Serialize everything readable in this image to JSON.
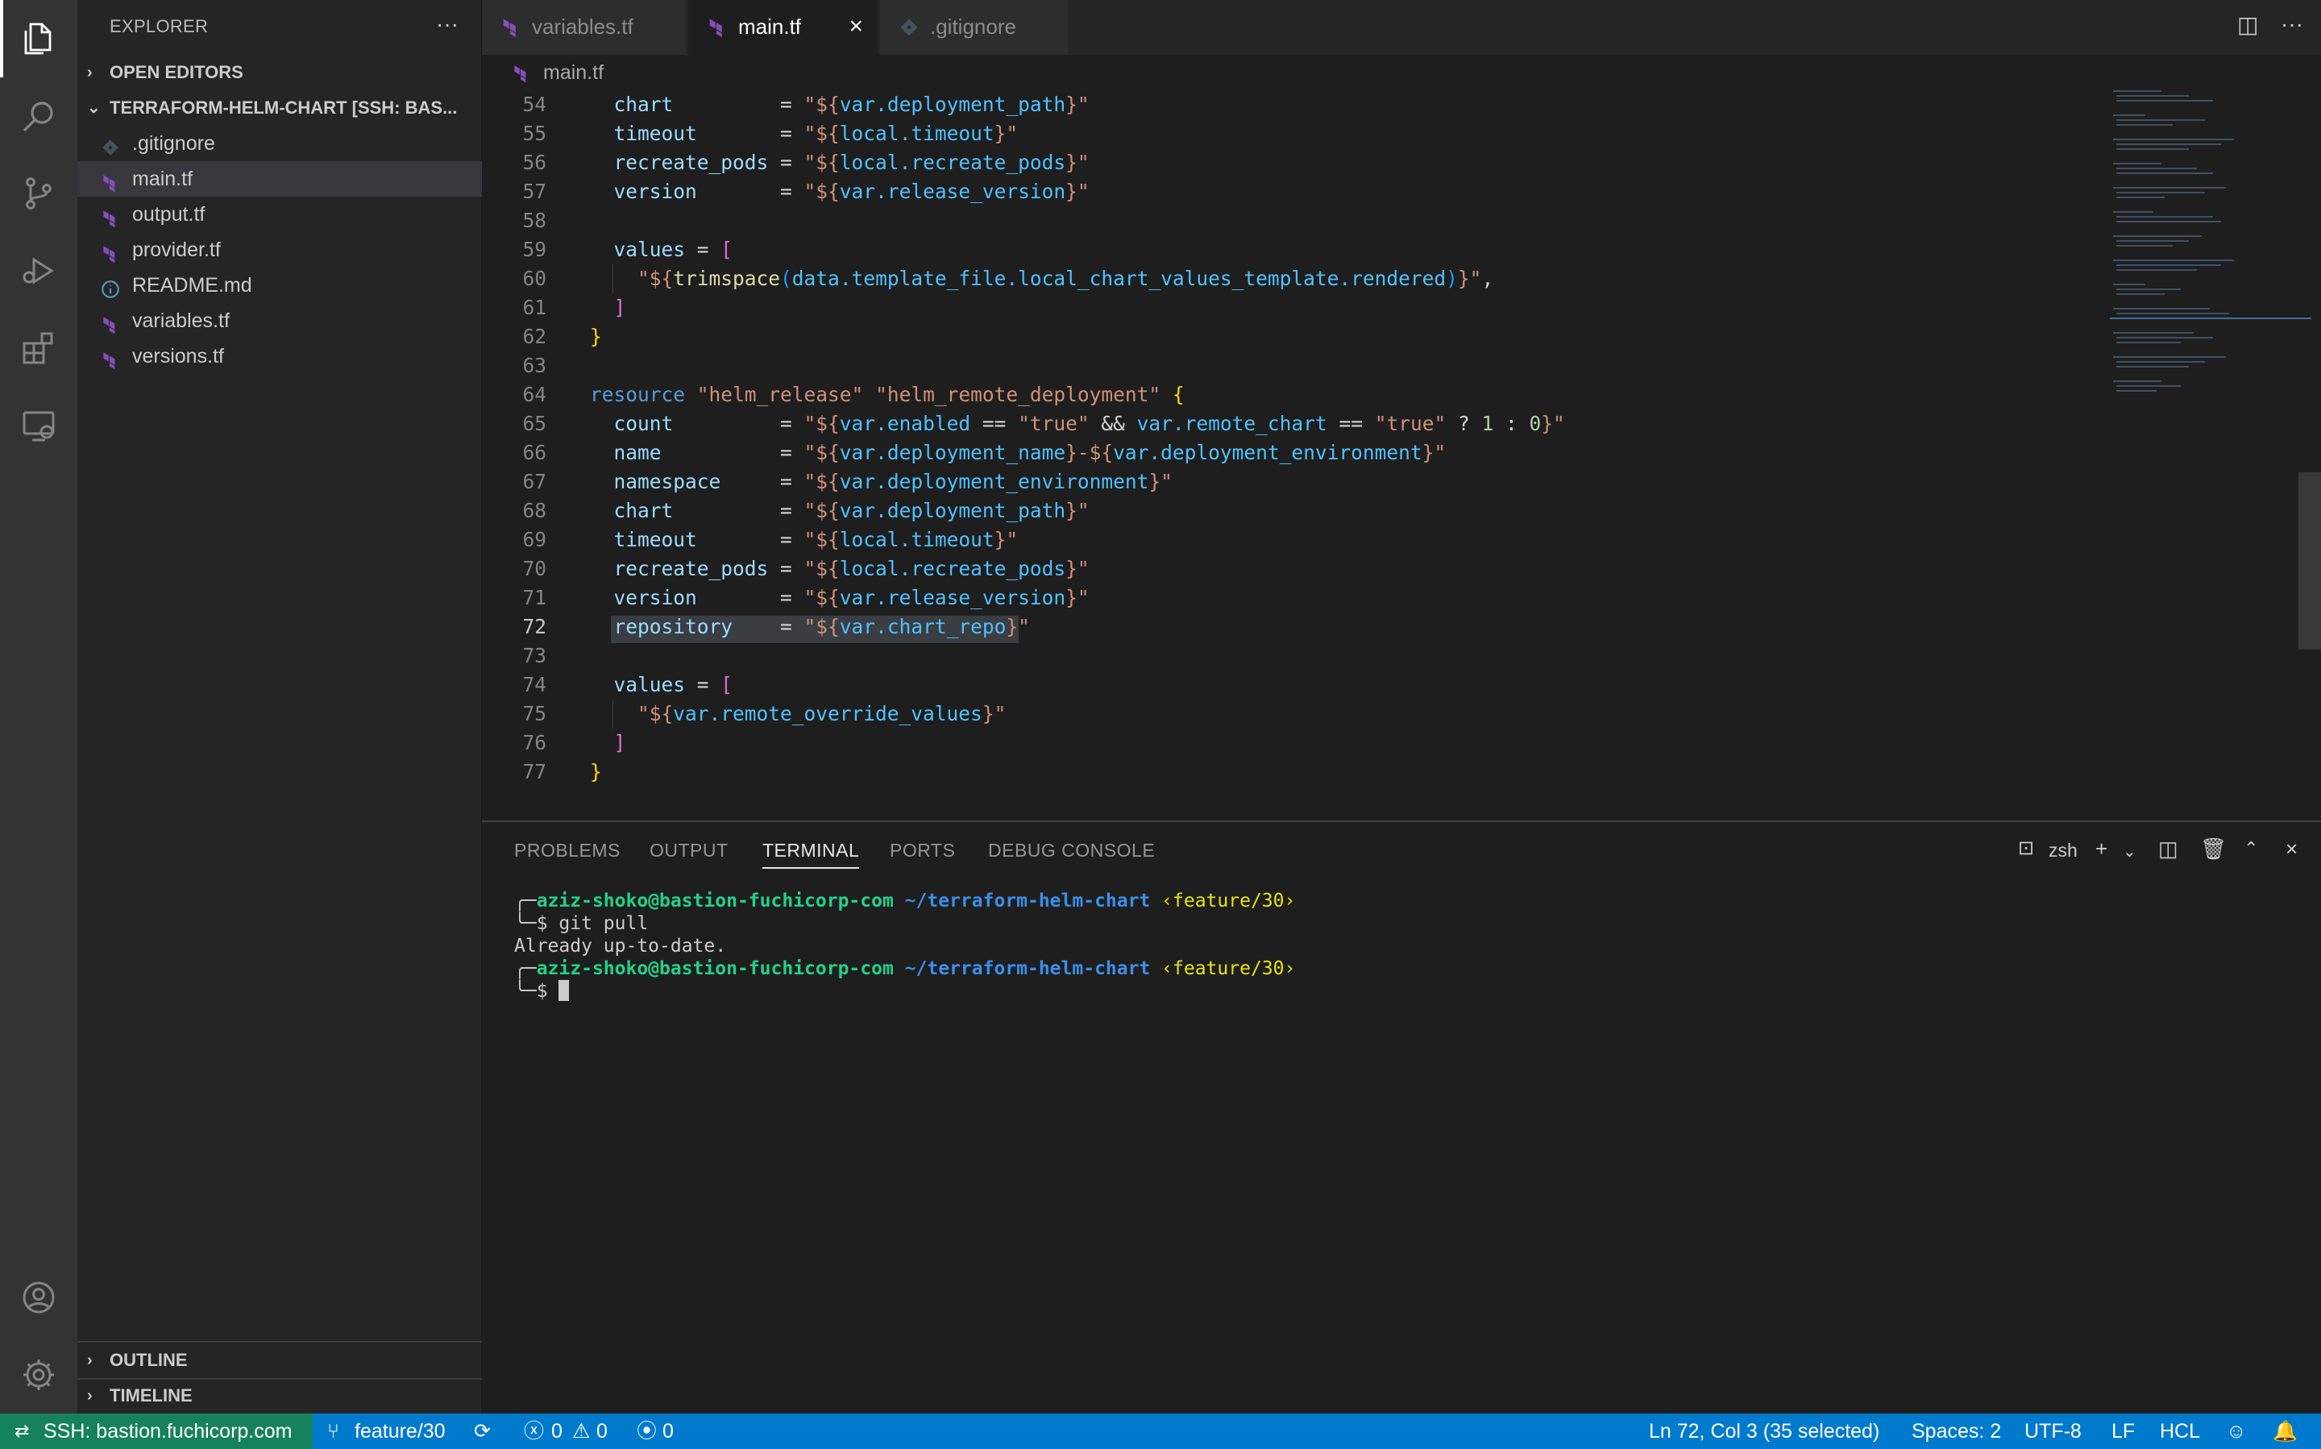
{
  "explorer": {
    "title": "EXPLORER",
    "more": "···",
    "open_editors": "OPEN EDITORS",
    "folder": "TERRAFORM-HELM-CHART [SSH: BAS...",
    "files": [
      {
        "name": ".gitignore",
        "icon": "git-icon"
      },
      {
        "name": "main.tf",
        "icon": "terraform-icon",
        "selected": true
      },
      {
        "name": "output.tf",
        "icon": "terraform-icon"
      },
      {
        "name": "provider.tf",
        "icon": "terraform-icon"
      },
      {
        "name": "README.md",
        "icon": "info-icon"
      },
      {
        "name": "variables.tf",
        "icon": "terraform-icon"
      },
      {
        "name": "versions.tf",
        "icon": "terraform-icon"
      }
    ],
    "outline": "OUTLINE",
    "timeline": "TIMELINE"
  },
  "tabs": [
    {
      "label": "variables.tf",
      "active": false
    },
    {
      "label": "main.tf",
      "active": true
    },
    {
      "label": ".gitignore",
      "active": false
    }
  ],
  "breadcrumb": "main.tf",
  "editor": {
    "current_line": 72,
    "lines": [
      {
        "n": "54",
        "tokens": [
          [
            "k-key",
            "  chart"
          ],
          [
            "k-op",
            "         = "
          ],
          [
            "k-str",
            "\"${"
          ],
          [
            "k-var",
            "var"
          ],
          [
            "k-dot",
            "."
          ],
          [
            "k-var",
            "deployment_path"
          ],
          [
            "k-str",
            "}\""
          ]
        ]
      },
      {
        "n": "55",
        "tokens": [
          [
            "k-key",
            "  timeout"
          ],
          [
            "k-op",
            "       = "
          ],
          [
            "k-str",
            "\"${"
          ],
          [
            "k-var",
            "local"
          ],
          [
            "k-dot",
            "."
          ],
          [
            "k-var",
            "timeout"
          ],
          [
            "k-str",
            "}\""
          ]
        ]
      },
      {
        "n": "56",
        "tokens": [
          [
            "k-key",
            "  recreate_pods"
          ],
          [
            "k-op",
            " = "
          ],
          [
            "k-str",
            "\"${"
          ],
          [
            "k-var",
            "local"
          ],
          [
            "k-dot",
            "."
          ],
          [
            "k-var",
            "recreate_pods"
          ],
          [
            "k-str",
            "}\""
          ]
        ]
      },
      {
        "n": "57",
        "tokens": [
          [
            "k-key",
            "  version"
          ],
          [
            "k-op",
            "       = "
          ],
          [
            "k-str",
            "\"${"
          ],
          [
            "k-var",
            "var"
          ],
          [
            "k-dot",
            "."
          ],
          [
            "k-var",
            "release_version"
          ],
          [
            "k-str",
            "}\""
          ]
        ]
      },
      {
        "n": "58",
        "tokens": []
      },
      {
        "n": "59",
        "tokens": [
          [
            "k-key",
            "  values"
          ],
          [
            "k-op",
            " = "
          ],
          [
            "k-brace2",
            "["
          ]
        ]
      },
      {
        "n": "60",
        "tokens": [
          [
            "k-str",
            "    \"${"
          ],
          [
            "k-fn",
            "trimspace"
          ],
          [
            "k-brace3",
            "("
          ],
          [
            "k-var",
            "data"
          ],
          [
            "k-dot",
            "."
          ],
          [
            "k-var",
            "template_file"
          ],
          [
            "k-dot",
            "."
          ],
          [
            "k-var",
            "local_chart_values_template"
          ],
          [
            "k-dot",
            "."
          ],
          [
            "k-var",
            "rendered"
          ],
          [
            "k-brace3",
            ")"
          ],
          [
            "k-str",
            "}\""
          ],
          [
            "k-op",
            ","
          ]
        ]
      },
      {
        "n": "61",
        "tokens": [
          [
            "k-brace2",
            "  ]"
          ]
        ]
      },
      {
        "n": "62",
        "tokens": [
          [
            "k-brace1",
            "}"
          ]
        ]
      },
      {
        "n": "63",
        "tokens": []
      },
      {
        "n": "64",
        "tokens": [
          [
            "k-kw",
            "resource"
          ],
          [
            "k-op",
            " "
          ],
          [
            "k-str",
            "\"helm_release\""
          ],
          [
            "k-op",
            " "
          ],
          [
            "k-str",
            "\"helm_remote_deployment\""
          ],
          [
            "k-op",
            " "
          ],
          [
            "k-brace1",
            "{"
          ]
        ]
      },
      {
        "n": "65",
        "tokens": [
          [
            "k-key",
            "  count"
          ],
          [
            "k-op",
            "         = "
          ],
          [
            "k-str",
            "\"${"
          ],
          [
            "k-var",
            "var"
          ],
          [
            "k-dot",
            "."
          ],
          [
            "k-var",
            "enabled"
          ],
          [
            "k-op",
            " == "
          ],
          [
            "k-str",
            "\"true\""
          ],
          [
            "k-op",
            " && "
          ],
          [
            "k-var",
            "var"
          ],
          [
            "k-dot",
            "."
          ],
          [
            "k-var",
            "remote_chart"
          ],
          [
            "k-op",
            " == "
          ],
          [
            "k-str",
            "\"true\""
          ],
          [
            "k-op",
            " ? "
          ],
          [
            "k-num",
            "1"
          ],
          [
            "k-op",
            " : "
          ],
          [
            "k-num",
            "0"
          ],
          [
            "k-str",
            "}\""
          ]
        ]
      },
      {
        "n": "66",
        "tokens": [
          [
            "k-key",
            "  name"
          ],
          [
            "k-op",
            "          = "
          ],
          [
            "k-str",
            "\"${"
          ],
          [
            "k-var",
            "var"
          ],
          [
            "k-dot",
            "."
          ],
          [
            "k-var",
            "deployment_name"
          ],
          [
            "k-str",
            "}-${"
          ],
          [
            "k-var",
            "var"
          ],
          [
            "k-dot",
            "."
          ],
          [
            "k-var",
            "deployment_environment"
          ],
          [
            "k-str",
            "}\""
          ]
        ]
      },
      {
        "n": "67",
        "tokens": [
          [
            "k-key",
            "  namespace"
          ],
          [
            "k-op",
            "     = "
          ],
          [
            "k-str",
            "\"${"
          ],
          [
            "k-var",
            "var"
          ],
          [
            "k-dot",
            "."
          ],
          [
            "k-var",
            "deployment_environment"
          ],
          [
            "k-str",
            "}\""
          ]
        ]
      },
      {
        "n": "68",
        "tokens": [
          [
            "k-key",
            "  chart"
          ],
          [
            "k-op",
            "         = "
          ],
          [
            "k-str",
            "\"${"
          ],
          [
            "k-var",
            "var"
          ],
          [
            "k-dot",
            "."
          ],
          [
            "k-var",
            "deployment_path"
          ],
          [
            "k-str",
            "}\""
          ]
        ]
      },
      {
        "n": "69",
        "tokens": [
          [
            "k-key",
            "  timeout"
          ],
          [
            "k-op",
            "       = "
          ],
          [
            "k-str",
            "\"${"
          ],
          [
            "k-var",
            "local"
          ],
          [
            "k-dot",
            "."
          ],
          [
            "k-var",
            "timeout"
          ],
          [
            "k-str",
            "}\""
          ]
        ]
      },
      {
        "n": "70",
        "tokens": [
          [
            "k-key",
            "  recreate_pods"
          ],
          [
            "k-op",
            " = "
          ],
          [
            "k-str",
            "\"${"
          ],
          [
            "k-var",
            "local"
          ],
          [
            "k-dot",
            "."
          ],
          [
            "k-var",
            "recreate_pods"
          ],
          [
            "k-str",
            "}\""
          ]
        ]
      },
      {
        "n": "71",
        "tokens": [
          [
            "k-key",
            "  version"
          ],
          [
            "k-op",
            "       = "
          ],
          [
            "k-str",
            "\"${"
          ],
          [
            "k-var",
            "var"
          ],
          [
            "k-dot",
            "."
          ],
          [
            "k-var",
            "release_version"
          ],
          [
            "k-str",
            "}\""
          ]
        ]
      },
      {
        "n": "72",
        "tokens": [
          [
            "k-key",
            "  repository"
          ],
          [
            "k-op",
            "    = "
          ],
          [
            "k-str",
            "\"${"
          ],
          [
            "k-var",
            "var"
          ],
          [
            "k-dot",
            "."
          ],
          [
            "k-var",
            "chart_repo"
          ],
          [
            "k-str",
            "}\""
          ]
        ]
      },
      {
        "n": "73",
        "tokens": []
      },
      {
        "n": "74",
        "tokens": [
          [
            "k-key",
            "  values"
          ],
          [
            "k-op",
            " = "
          ],
          [
            "k-brace2",
            "["
          ]
        ]
      },
      {
        "n": "75",
        "tokens": [
          [
            "k-str",
            "    \"${"
          ],
          [
            "k-var",
            "var"
          ],
          [
            "k-dot",
            "."
          ],
          [
            "k-var",
            "remote_override_values"
          ],
          [
            "k-str",
            "}\""
          ]
        ]
      },
      {
        "n": "76",
        "tokens": [
          [
            "k-brace2",
            "  ]"
          ]
        ]
      },
      {
        "n": "77",
        "tokens": [
          [
            "k-brace1",
            "}"
          ]
        ]
      }
    ]
  },
  "panel": {
    "tabs": [
      "PROBLEMS",
      "OUTPUT",
      "TERMINAL",
      "PORTS",
      "DEBUG CONSOLE"
    ],
    "active_tab": "TERMINAL",
    "shell": "zsh",
    "terminal": {
      "prompt1_user": "aziz-shoko@bastion-fuchicorp-com",
      "prompt1_path": "~/terraform-helm-chart",
      "prompt1_branch": "‹feature/30›",
      "command": "$ git pull",
      "output": "Already up-to-date.",
      "prompt2_user": "aziz-shoko@bastion-fuchicorp-com",
      "prompt2_path": "~/terraform-helm-chart",
      "prompt2_branch": "‹feature/30›",
      "prompt2_symbol": "$"
    }
  },
  "status": {
    "remote": "SSH: bastion.fuchicorp.com",
    "branch": "feature/30",
    "errors": "0",
    "warnings": "0",
    "ports": "0",
    "position": "Ln 72, Col 3 (35 selected)",
    "spaces": "Spaces: 2",
    "encoding": "UTF-8",
    "eol": "LF",
    "language": "HCL"
  },
  "colors": {
    "statusbar": "#007acc",
    "remote": "#16825d",
    "terraform": "#844fba"
  }
}
